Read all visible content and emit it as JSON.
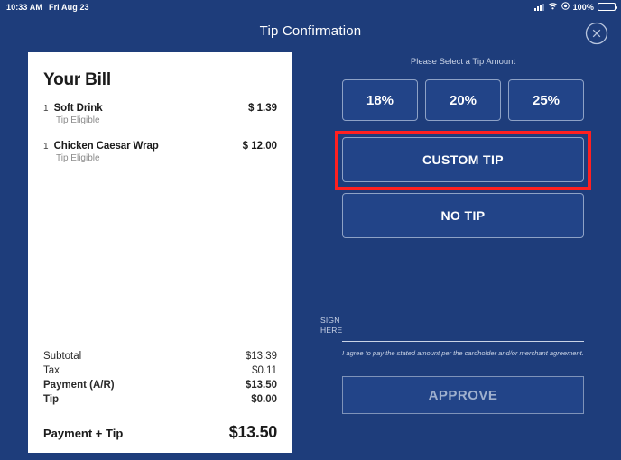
{
  "status_bar": {
    "time": "10:33 AM",
    "date": "Fri Aug 23",
    "battery_percent": "100%",
    "signal_icon": "cellular-signal-icon",
    "wifi_icon": "wifi-icon",
    "location_icon": "location-services-icon",
    "battery_icon": "battery-icon"
  },
  "header": {
    "title": "Tip Confirmation",
    "close_icon": "close-circle-icon"
  },
  "bill": {
    "heading": "Your Bill",
    "items": [
      {
        "qty": "1",
        "name": "Soft Drink",
        "note": "Tip Eligible",
        "price": "$ 1.39"
      },
      {
        "qty": "1",
        "name": "Chicken Caesar Wrap",
        "note": "Tip Eligible",
        "price": "$ 12.00"
      }
    ],
    "totals": [
      {
        "label": "Subtotal",
        "value": "$13.39",
        "bold": false
      },
      {
        "label": "Tax",
        "value": "$0.11",
        "bold": false
      },
      {
        "label": "Payment (A/R)",
        "value": "$13.50",
        "bold": true
      },
      {
        "label": "Tip",
        "value": "$0.00",
        "bold": true
      }
    ],
    "grand_total_label": "Payment + Tip",
    "grand_total_value": "$13.50"
  },
  "tip_panel": {
    "prompt": "Please Select a Tip Amount",
    "options": [
      {
        "label": "18%"
      },
      {
        "label": "20%"
      },
      {
        "label": "25%"
      }
    ],
    "custom_tip_label": "CUSTOM TIP",
    "no_tip_label": "NO TIP",
    "highlighted_option": "CUSTOM TIP",
    "highlight_color": "#ff2020"
  },
  "signature": {
    "sign_here_line1": "SIGN",
    "sign_here_line2": "HERE",
    "disclaimer": "I agree to pay the stated amount per the cardholder and/or merchant agreement.",
    "approve_label": "APPROVE"
  },
  "theme": {
    "background": "#1e3d7b",
    "card_background": "#ffffff",
    "button_background": "#224488",
    "button_border": "#8ea2c6"
  }
}
